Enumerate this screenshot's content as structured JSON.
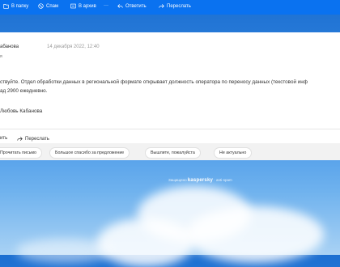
{
  "toolbar": {
    "folder": "В папку",
    "spam": "Спам",
    "archive": "В архив",
    "more": "···",
    "reply": "Ответить",
    "forward": "Переслать"
  },
  "message": {
    "sender": "Любовь Кабанова",
    "sender_visible": "абанова",
    "date": "14 декабря 2022, 12:40",
    "recipient_visible": "я",
    "body_line1": "ствуйте. Отдел обработки данных в региональной формате открывает должность оператора по переносу данных (текстовой инф",
    "body_line2": "ад 2900 ежедневно.",
    "signature": "Любовь Кабанова"
  },
  "actions": {
    "reply": "ить",
    "forward": "Переслать"
  },
  "quick_replies": [
    "Прочитать письмо",
    "Большое спасибо за предложение",
    "Вышлите, пожалуйста",
    "Не актуально"
  ],
  "footer": {
    "protected_by": "Защищено",
    "brand": "kaspersky",
    "detail": "· anti-spam"
  },
  "colors": {
    "toolbar": "#0a72f0",
    "background": "#3c8fe6"
  }
}
